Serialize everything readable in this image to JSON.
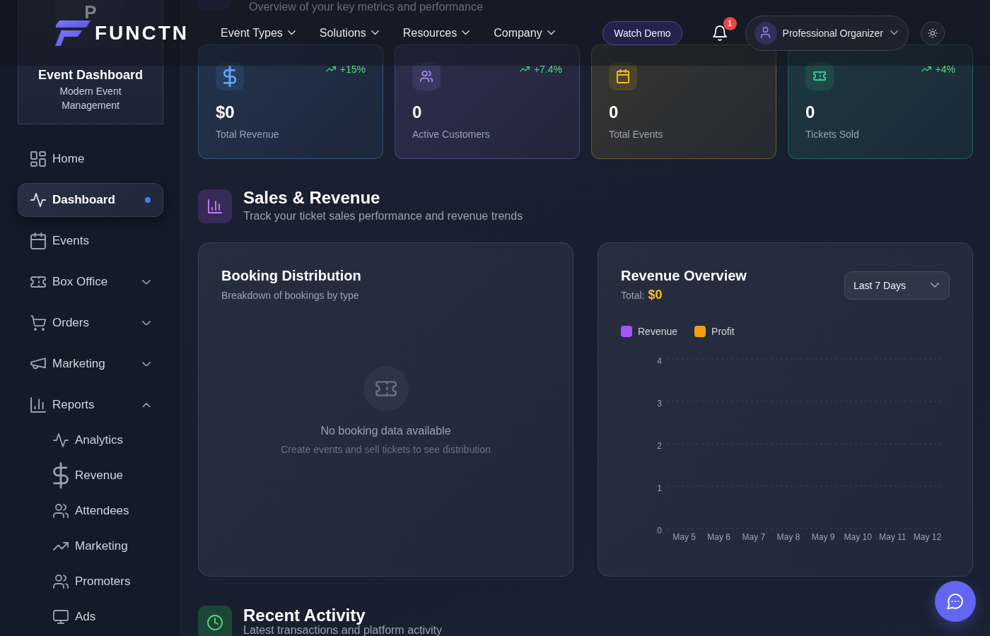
{
  "header": {
    "logo_text": "FUNCTN",
    "nav": [
      "Event Types",
      "Solutions",
      "Resources",
      "Company"
    ],
    "demo_button": "Watch Demo",
    "notifications": {
      "badge": "1"
    },
    "user": {
      "name": "Professional Organizer"
    }
  },
  "sidebar": {
    "brand": {
      "initial": "P",
      "title": "Event Dashboard",
      "subtitle": "Modern Event Management"
    },
    "items": [
      {
        "label": "Home",
        "selected": false
      },
      {
        "label": "Dashboard",
        "selected": true
      },
      {
        "label": "Events",
        "selected": false
      },
      {
        "label": "Box Office",
        "selected": false,
        "expanded": false
      },
      {
        "label": "Orders",
        "selected": false,
        "expanded": false
      },
      {
        "label": "Marketing",
        "selected": false,
        "expanded": false
      },
      {
        "label": "Reports",
        "selected": false,
        "expanded": true,
        "children": [
          {
            "label": "Analytics",
            "selected": false
          },
          {
            "label": "Revenue",
            "selected": false
          },
          {
            "label": "Attendees",
            "selected": false
          },
          {
            "label": "Marketing",
            "selected": false
          },
          {
            "label": "Promoters",
            "selected": false
          },
          {
            "label": "Ads",
            "selected": false
          }
        ]
      }
    ]
  },
  "page_header": {
    "subtitle": "Overview of your key metrics and performance"
  },
  "stats": [
    {
      "value": "$0",
      "label": "Total Revenue",
      "trend": "+15%",
      "color": "#60a5fa"
    },
    {
      "value": "0",
      "label": "Active Customers",
      "trend": "+7.4%",
      "color": "#a78bfa"
    },
    {
      "value": "0",
      "label": "Total Events",
      "color": "#fbbf24"
    },
    {
      "value": "0",
      "label": "Tickets Sold",
      "trend": "+4%",
      "color": "#34d399"
    }
  ],
  "sales_section": {
    "title": "Sales & Revenue",
    "subtitle": "Track your ticket sales performance and revenue trends",
    "booking_distribution": {
      "title": "Booking Distribution",
      "subtitle": "Breakdown of bookings by type",
      "empty_title": "No booking data available",
      "empty_text": "Create events and sell tickets to see distribution"
    },
    "revenue_overview": {
      "title": "Revenue Overview",
      "total_label": "Total:",
      "total_value": "$0",
      "range": "Last 7 Days",
      "chart_data": {
        "type": "bar",
        "categories": [
          "May 5",
          "May 6",
          "May 7",
          "May 8",
          "May 9",
          "May 10",
          "May 11",
          "May 12"
        ],
        "ylim": [
          0,
          4
        ],
        "yticks": [
          0,
          1,
          2,
          3,
          4
        ],
        "grid": true,
        "series": [
          {
            "name": "Revenue",
            "color": "#a855f7",
            "values": [
              null,
              null,
              null,
              null,
              null,
              null,
              null,
              null
            ]
          },
          {
            "name": "Profit",
            "color": "#f59e0b",
            "values": [
              null,
              null,
              null,
              null,
              null,
              null,
              null,
              null
            ]
          }
        ]
      }
    }
  },
  "activity_section": {
    "title": "Recent Activity",
    "subtitle": "Latest transactions and platform activity"
  }
}
